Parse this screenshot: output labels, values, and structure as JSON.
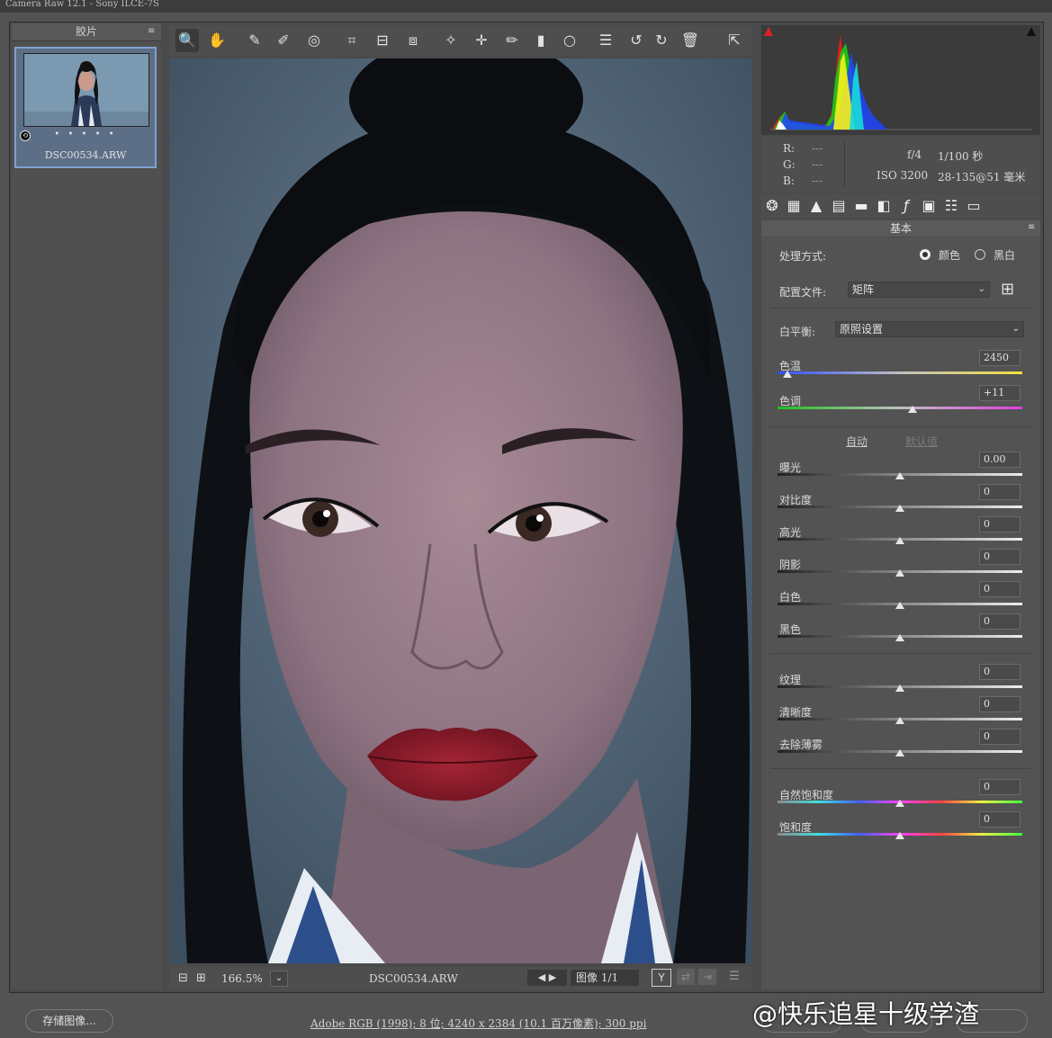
{
  "window": {
    "title": "Camera Raw 12.1 - Sony ILCE-7S"
  },
  "filmstrip": {
    "header": "胶片",
    "menu_icon": "≡",
    "thumbnail": {
      "filename": "DSC00534.ARW",
      "rating_dots": "• • • • •"
    }
  },
  "toolbar": {
    "tools": [
      {
        "name": "zoom-tool",
        "glyph": "🔍"
      },
      {
        "name": "hand-tool",
        "glyph": "✋"
      },
      {
        "name": "white-balance-tool",
        "glyph": "✎"
      },
      {
        "name": "color-sampler-tool",
        "glyph": "✐"
      },
      {
        "name": "targeted-adjustment-tool",
        "glyph": "◎"
      },
      {
        "name": "crop-tool",
        "glyph": "⌗"
      },
      {
        "name": "straighten-tool",
        "glyph": "⊟"
      },
      {
        "name": "transform-tool",
        "glyph": "⧈"
      },
      {
        "name": "spot-removal-tool",
        "glyph": "✧"
      },
      {
        "name": "red-eye-tool",
        "glyph": "✛"
      },
      {
        "name": "adjustment-brush-tool",
        "glyph": "✏"
      },
      {
        "name": "graduated-filter-tool",
        "glyph": "▮"
      },
      {
        "name": "radial-filter-tool",
        "glyph": "○"
      },
      {
        "name": "preferences-tool",
        "glyph": "☰"
      },
      {
        "name": "rotate-ccw-tool",
        "glyph": "↺"
      },
      {
        "name": "rotate-cw-tool",
        "glyph": "↻"
      },
      {
        "name": "delete-tool",
        "glyph": "🗑"
      },
      {
        "name": "fullscreen-tool",
        "glyph": "⇱"
      }
    ]
  },
  "statusbar": {
    "zoom": "166.5%",
    "filename": "DSC00534.ARW",
    "image_counter": "图像 1/1"
  },
  "info": {
    "r_label": "R:",
    "g_label": "G:",
    "b_label": "B:",
    "r_value": "---",
    "g_value": "---",
    "b_value": "---",
    "aperture": "f/4",
    "shutter": "1/100 秒",
    "iso": "ISO 3200",
    "lens": "28-135@51 毫米"
  },
  "panel": {
    "title": "基本",
    "treatment_label": "处理方式:",
    "treatment_color": "颜色",
    "treatment_bw": "黑白",
    "profile_label": "配置文件:",
    "profile_value": "矩阵",
    "wb_label": "白平衡:",
    "wb_value": "原照设置",
    "auto_label": "自动",
    "default_label": "默认值",
    "sliders": [
      {
        "label": "色温",
        "value": "2450",
        "pos": 0.04
      },
      {
        "label": "色调",
        "value": "+11",
        "pos": 0.55
      },
      {
        "label": "曝光",
        "value": "0.00",
        "pos": 0.5
      },
      {
        "label": "对比度",
        "value": "0",
        "pos": 0.5
      },
      {
        "label": "高光",
        "value": "0",
        "pos": 0.5
      },
      {
        "label": "阴影",
        "value": "0",
        "pos": 0.5
      },
      {
        "label": "白色",
        "value": "0",
        "pos": 0.5
      },
      {
        "label": "黑色",
        "value": "0",
        "pos": 0.5
      },
      {
        "label": "纹理",
        "value": "0",
        "pos": 0.5
      },
      {
        "label": "清晰度",
        "value": "0",
        "pos": 0.5
      },
      {
        "label": "去除薄雾",
        "value": "0",
        "pos": 0.5
      },
      {
        "label": "自然饱和度",
        "value": "0",
        "pos": 0.5
      },
      {
        "label": "饱和度",
        "value": "0",
        "pos": 0.5
      }
    ]
  },
  "bottom": {
    "save_button": "存储图像...",
    "file_info": "Adobe RGB (1998); 8 位; 4240 x 2384 (10.1 百万像素); 300 ppi",
    "watermark": "@快乐追星十级学渣"
  },
  "colors": {
    "accent": "#7ea0cf",
    "panel_bg": "#535353",
    "histogram_bg": "#3b3b3b",
    "lip": "#8e1c2a"
  }
}
